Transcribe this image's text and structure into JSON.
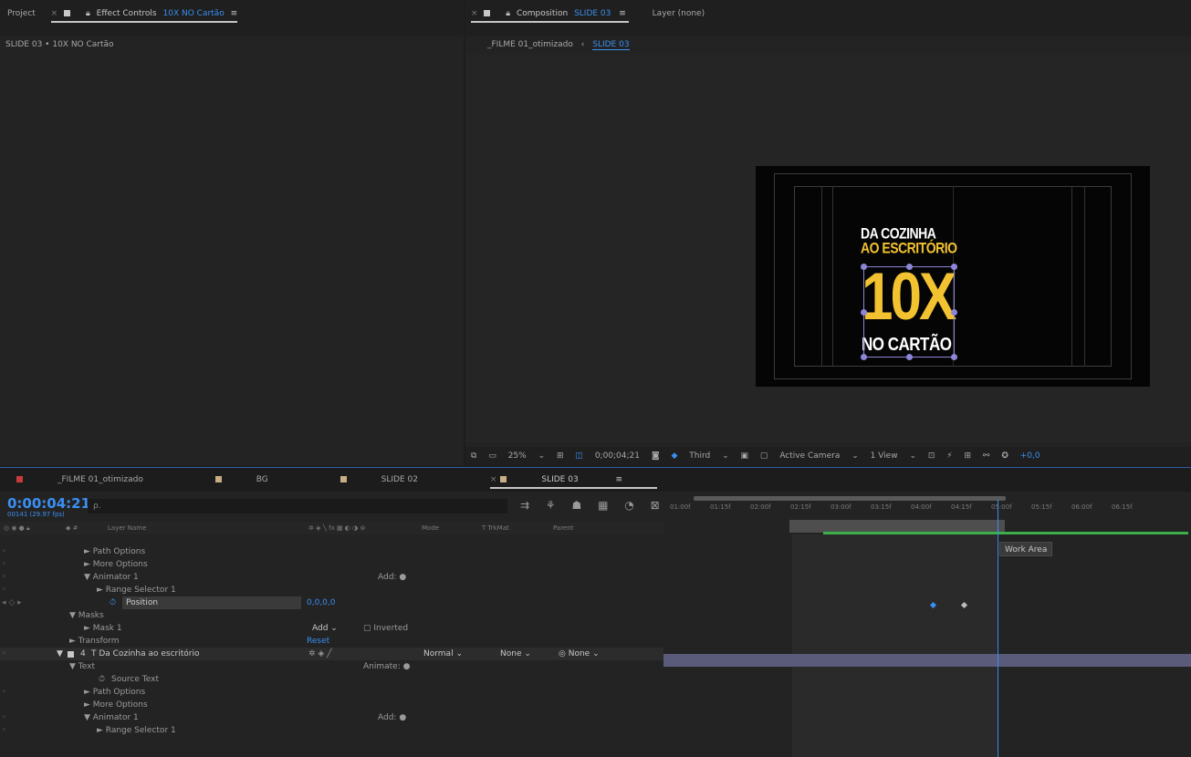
{
  "effect_panel": {
    "tab_project": "Project",
    "tab_effect_prefix": "Effect Controls",
    "tab_effect_layer": "10X  NO Cartão",
    "breadcrumb": "SLIDE 03 • 10X  NO Cartão"
  },
  "comp_panel": {
    "tab_comp_prefix": "Composition",
    "tab_comp_name": "SLIDE 03",
    "tab_layer": "Layer (none)",
    "crumb_parent": "_FILME 01_otimizado",
    "crumb_current": "SLIDE 03"
  },
  "comp_preview": {
    "line1": "DA COZINHA",
    "line2": "AO ESCRITÓRIO",
    "line3": "10X",
    "line4": "NO CARTÃO"
  },
  "viewer_toolbar": {
    "zoom": "25%",
    "timecode": "0;00;04;21",
    "resolution": "Third",
    "camera": "Active Camera",
    "views": "1 View",
    "exposure": "+0,0"
  },
  "timeline_tabs": [
    {
      "label": "_FILME 01_otimizado",
      "color": "#c63c3c"
    },
    {
      "label": "BG",
      "color": "#c9ad84"
    },
    {
      "label": "SLIDE 02",
      "color": "#c9ad84"
    },
    {
      "label": "SLIDE 03",
      "color": "#c9ad84"
    }
  ],
  "timeline": {
    "timecode": "0:00:04:21",
    "fps": "00141 (29.97 fps)",
    "search_placeholder": "ρ.",
    "columns": {
      "layer_name": "Layer Name",
      "mode": "Mode",
      "trkmat": "T  TrkMat",
      "parent": "Parent"
    },
    "ruler_ticks": [
      "01:00f",
      "01:15f",
      "02:00f",
      "02:15f",
      "03:00f",
      "03:15f",
      "04:00f",
      "04:15f",
      "05:00f",
      "05:15f",
      "06:00f",
      "06:15f"
    ],
    "work_area_tip": "Work Area"
  },
  "layers": [
    {
      "label": "► Path Options",
      "indent": 92
    },
    {
      "label": "► More Options",
      "indent": 92
    },
    {
      "label": "▼ Animator 1",
      "indent": 92,
      "right": "Add: ●"
    },
    {
      "label": "► Range Selector 1",
      "indent": 106
    },
    {
      "label": "Position",
      "indent": 122,
      "value": "0,0,0,0",
      "selected": true
    },
    {
      "label": "▼ Masks",
      "indent": 76
    },
    {
      "label": "► Mask 1",
      "indent": 92,
      "mask_mode": "Add",
      "mask_inverted": "Inverted"
    },
    {
      "label": "► Transform",
      "indent": 76,
      "reset": "Reset"
    },
    {
      "label": "T  Da Cozinha ao escritório",
      "indent": 100,
      "num": "4",
      "layer": true,
      "mode": "Normal",
      "trkmat": "None",
      "parent": "None"
    },
    {
      "label": "▼ Text",
      "indent": 76,
      "right": "Animate: ●"
    },
    {
      "label": "Source Text",
      "indent": 122
    },
    {
      "label": "► Path Options",
      "indent": 92
    },
    {
      "label": "► More Options",
      "indent": 92
    },
    {
      "label": "▼ Animator 1",
      "indent": 92,
      "right": "Add: ●"
    },
    {
      "label": "► Range Selector 1",
      "indent": 106
    }
  ]
}
